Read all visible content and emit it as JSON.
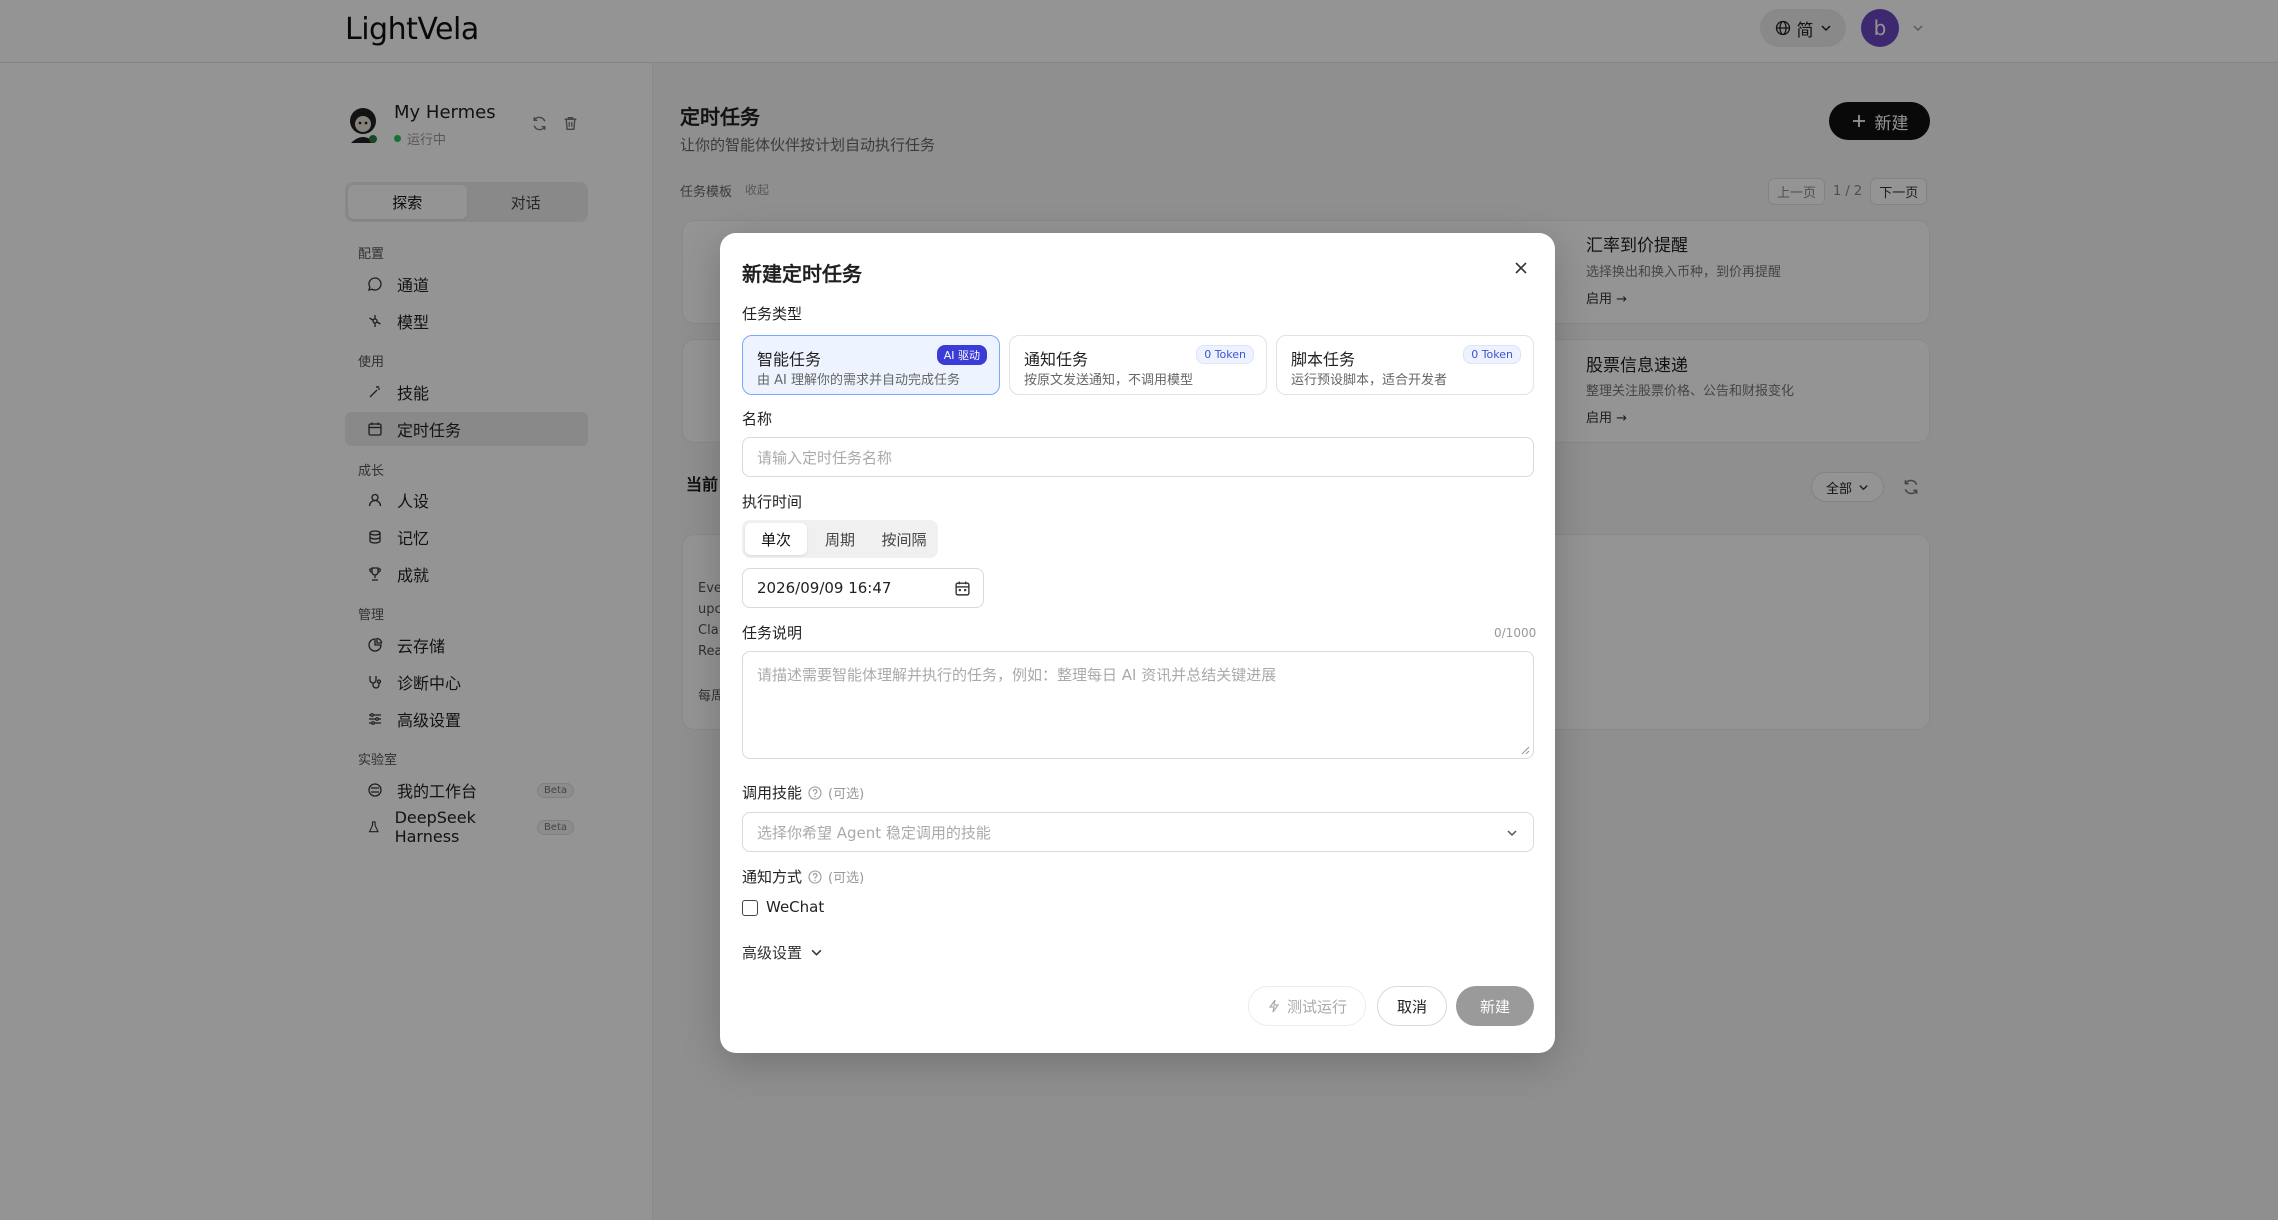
{
  "app": {
    "logo": "LightVela",
    "lang": "简",
    "user_initial": "b"
  },
  "agent": {
    "name": "My Hermes",
    "status": "运行中"
  },
  "sidebar": {
    "tabs": [
      "探索",
      "对话"
    ],
    "groups": {
      "config": "配置",
      "use": "使用",
      "growth": "成长",
      "manage": "管理",
      "lab": "实验室"
    },
    "items": {
      "channel": "通道",
      "model": "模型",
      "skills": "技能",
      "scheduled": "定时任务",
      "persona": "人设",
      "memory": "记忆",
      "achievement": "成就",
      "storage": "云存储",
      "diagnosis": "诊断中心",
      "advanced": "高级设置",
      "workspace": "我的工作台",
      "deepseek": "DeepSeek Harness"
    },
    "beta": "Beta"
  },
  "main": {
    "title": "定时任务",
    "subtitle": "让你的智能体伙伴按计划自动执行任务",
    "new_button": "新建",
    "templates_label": "任务模板",
    "collapse": "收起",
    "pager": {
      "prev": "上一页",
      "page": "1 / 2",
      "next": "下一页"
    },
    "cards": [
      {
        "title": "汇率到价提醒",
        "desc": "选择换出和换入币种，到价再提醒",
        "link": "启用"
      },
      {
        "title": "股票信息速递",
        "desc": "整理关注股票价格、公告和财报变化",
        "link": "启用"
      }
    ],
    "current_tab": "当前",
    "filter": "全部",
    "bg_task_text": [
      "Eve",
      "upc",
      "Cla",
      "Rea",
      "每周"
    ]
  },
  "modal": {
    "title": "新建定时任务",
    "type_label": "任务类型",
    "types": [
      {
        "name": "智能任务",
        "desc": "由 AI 理解你的需求并自动完成任务",
        "badge": "AI 驱动"
      },
      {
        "name": "通知任务",
        "desc": "按原文发送通知，不调用模型",
        "badge": "0 Token"
      },
      {
        "name": "脚本任务",
        "desc": "运行预设脚本，适合开发者",
        "badge": "0 Token"
      }
    ],
    "name_label": "名称",
    "name_placeholder": "请输入定时任务名称",
    "time_label": "执行时间",
    "time_modes": [
      "单次",
      "周期",
      "按间隔"
    ],
    "datetime": "2026/09/09 16:47",
    "desc_label": "任务说明",
    "desc_counter": "0/1000",
    "desc_placeholder": "请描述需要智能体理解并执行的任务，例如：整理每日 AI 资讯并总结关键进展",
    "skills_label": "调用技能",
    "optional": "(可选)",
    "skills_placeholder": "选择你希望 Agent 稳定调用的技能",
    "notify_label": "通知方式",
    "notify_option": "WeChat",
    "advanced": "高级设置",
    "test_run": "测试运行",
    "cancel": "取消",
    "create": "新建"
  },
  "colors": {
    "primary": "#111111",
    "selected_border": "#7aa7ff",
    "ai_badge": "#3b3bd6",
    "status_green": "#22c55e",
    "disabled": "#9a9a9a"
  }
}
